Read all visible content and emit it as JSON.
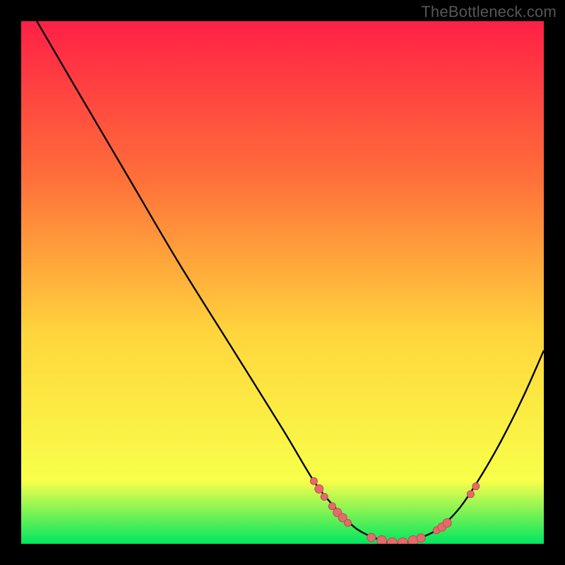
{
  "watermark": "TheBottleneck.com",
  "colors": {
    "background": "#000000",
    "gradient_top": "#ff2046",
    "gradient_mid1": "#ff6f3a",
    "gradient_mid2": "#ffd63c",
    "gradient_mid3": "#f8ff4a",
    "gradient_bottom": "#00e660",
    "curve": "#000000",
    "dot_fill": "#e66a6a",
    "dot_stroke": "#b84f4f"
  },
  "chart_data": {
    "type": "line",
    "title": "",
    "xlabel": "",
    "ylabel": "",
    "xlim": [
      0,
      100
    ],
    "ylim": [
      0,
      100
    ],
    "grid": false,
    "legend": false,
    "series": [
      {
        "name": "bottleneck-curve",
        "x": [
          3,
          10,
          20,
          30,
          40,
          50,
          56,
          60,
          64,
          68,
          72,
          76,
          80,
          84,
          88,
          92,
          96,
          100
        ],
        "y": [
          100,
          88,
          71,
          54,
          38,
          22,
          12,
          7,
          3,
          1,
          0,
          1,
          3,
          7,
          13,
          20,
          28,
          37
        ]
      }
    ],
    "markers": [
      {
        "x": 56,
        "y": 12,
        "r": 5
      },
      {
        "x": 57,
        "y": 10.5,
        "r": 6
      },
      {
        "x": 58,
        "y": 9,
        "r": 5
      },
      {
        "x": 59.5,
        "y": 7.2,
        "r": 5
      },
      {
        "x": 60.5,
        "y": 6.0,
        "r": 6
      },
      {
        "x": 61.5,
        "y": 5.0,
        "r": 6
      },
      {
        "x": 62.5,
        "y": 4.0,
        "r": 5
      },
      {
        "x": 67,
        "y": 1.2,
        "r": 6
      },
      {
        "x": 69,
        "y": 0.6,
        "r": 7
      },
      {
        "x": 71,
        "y": 0.2,
        "r": 7
      },
      {
        "x": 73,
        "y": 0.2,
        "r": 7
      },
      {
        "x": 75,
        "y": 0.6,
        "r": 7
      },
      {
        "x": 76.5,
        "y": 1.1,
        "r": 6
      },
      {
        "x": 79.5,
        "y": 2.6,
        "r": 5
      },
      {
        "x": 80.5,
        "y": 3.2,
        "r": 6
      },
      {
        "x": 81.5,
        "y": 4.0,
        "r": 6
      },
      {
        "x": 86,
        "y": 9.5,
        "r": 5
      },
      {
        "x": 87,
        "y": 11.0,
        "r": 5
      }
    ]
  }
}
